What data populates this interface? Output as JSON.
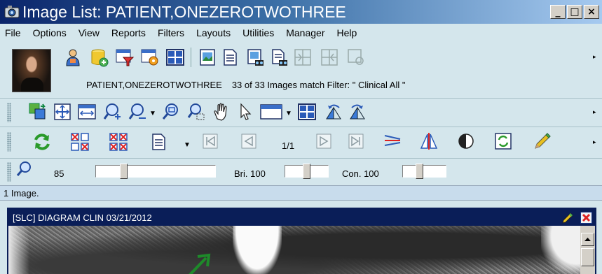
{
  "window": {
    "title": "Image List: PATIENT,ONEZEROTWOTHREE",
    "minimize_glyph": "_",
    "maximize_glyph": "□",
    "close_glyph": "×"
  },
  "menu": [
    "File",
    "Options",
    "View",
    "Reports",
    "Filters",
    "Layouts",
    "Utilities",
    "Manager",
    "Help"
  ],
  "patient_bar": {
    "patient_name": "PATIENT,ONEZEROTWOTHREE",
    "filter_status": "33 of 33 Images match Filter: \" Clinical All \""
  },
  "toolbar_1_icons": [
    "patient-info-icon",
    "database-icon",
    "filter-icon",
    "preferences-icon",
    "layout-grid-icon",
    "image-icon",
    "document-icon",
    "image-search-icon",
    "document-search-icon",
    "split-left-icon",
    "split-right-icon",
    "settings-icon"
  ],
  "toolbar_2_icons": [
    "copy-images-icon",
    "fit-icon",
    "fit-width-icon",
    "zoom-in-icon",
    "zoom-out-icon",
    "zoom-fit-icon",
    "zoom-select-icon",
    "pan-hand-icon",
    "pointer-icon",
    "window-icon",
    "grid-icon",
    "rotate-left-icon",
    "rotate-right-icon"
  ],
  "toolbar_3": {
    "page_indicator": "1/1",
    "icons": [
      "refresh-icon",
      "clear-selected-icon",
      "clear-all-icon",
      "document-icon",
      "first-page-icon",
      "prev-page-icon",
      "next-page-icon",
      "last-page-icon",
      "flip-horizontal-icon",
      "mirror-icon",
      "invert-icon",
      "reset-icon",
      "annotate-pencil-icon"
    ]
  },
  "toolbar_4": {
    "zoom_value": "85",
    "brightness_label": "Bri. 100",
    "contrast_label": "Con. 100"
  },
  "info_line": "1 Image.",
  "image_window": {
    "title": "[SLC] DIAGRAM CLIN 03/21/2012"
  },
  "colors": {
    "title_gradient_start": "#0a246a",
    "panel_background": "#d4e6ec",
    "image_window_title": "#0a1e58"
  }
}
